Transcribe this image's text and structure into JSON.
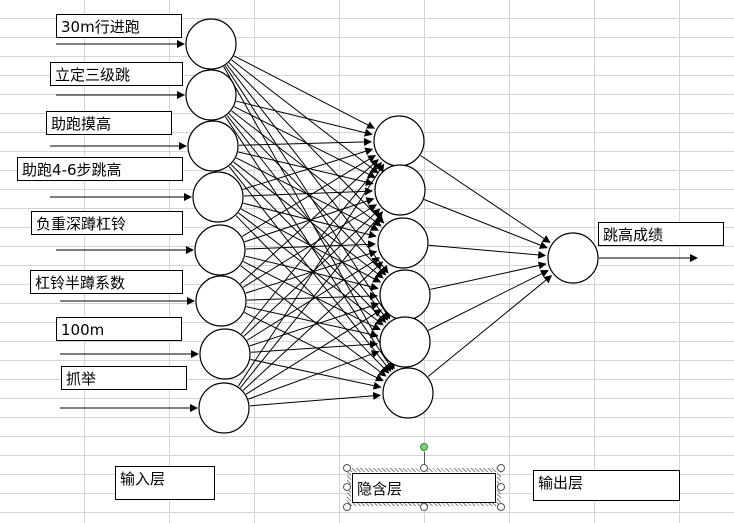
{
  "input_labels": [
    "30m行进跑",
    "立定三级跳",
    "助跑摸高",
    "助跑4-6步跳高",
    "负重深蹲杠铃",
    "杠铃半蹲系数",
    "100m",
    "抓举"
  ],
  "output_label": "跳高成绩",
  "layer_labels": {
    "input": "输入层",
    "hidden": "隐含层",
    "output": "输出层"
  },
  "network": {
    "input_nodes": 8,
    "hidden_nodes": 6,
    "output_nodes": 1
  }
}
